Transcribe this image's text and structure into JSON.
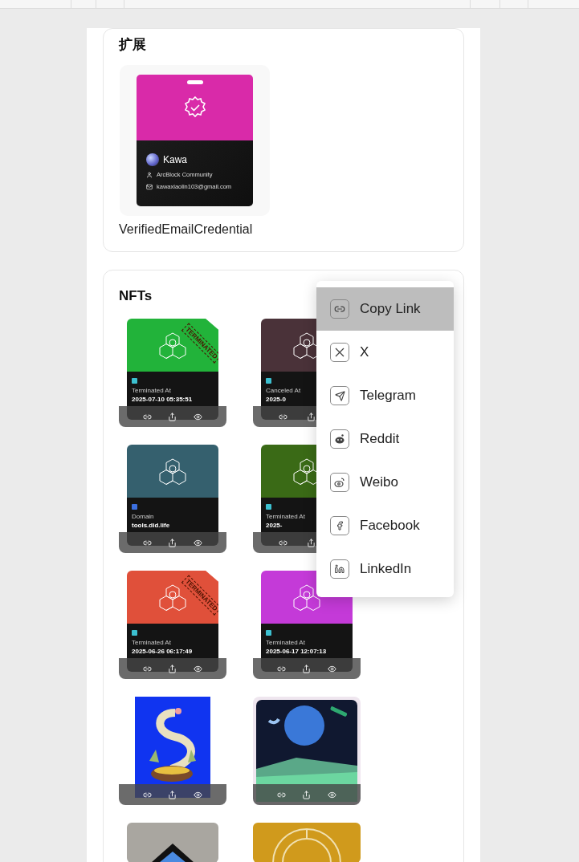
{
  "extensions": {
    "title": "扩展",
    "credential": {
      "name": "Kawa",
      "organization": "ArcBlock Community",
      "email": "kawaxiaolin103@gmail.com",
      "label": "VerifiedEmailCredential"
    }
  },
  "nfts": {
    "title": "NFTs",
    "items": [
      {
        "kind": "certificate",
        "color": "#22b33a",
        "stamp": "TERMINATED",
        "field_label": "Terminated At",
        "field_value": "2025-07-10 05:35:51"
      },
      {
        "kind": "certificate",
        "color": "#4a3239",
        "field_label": "Canceled At",
        "field_value": "2025-0"
      },
      {
        "kind": "domain",
        "color": "#35606e",
        "field_label": "Domain",
        "field_value": "tools.did.life"
      },
      {
        "kind": "certificate",
        "color": "#3a6a16",
        "field_label": "Terminated At",
        "field_value": "2025-"
      },
      {
        "kind": "certificate",
        "color": "#e0503a",
        "stamp": "TERMINATED",
        "field_label": "Terminated At",
        "field_value": "2025-06-26 06:17:49"
      },
      {
        "kind": "certificate",
        "color": "#c43ad8",
        "field_label": "Terminated At",
        "field_value": "2025-06-17 12:07:13"
      },
      {
        "kind": "picture"
      },
      {
        "kind": "picture"
      },
      {
        "kind": "picture"
      },
      {
        "kind": "picture"
      }
    ]
  },
  "share_menu": {
    "items": [
      {
        "label": "Copy Link",
        "selected": true
      },
      {
        "label": "X",
        "selected": false
      },
      {
        "label": "Telegram",
        "selected": false
      },
      {
        "label": "Reddit",
        "selected": false
      },
      {
        "label": "Weibo",
        "selected": false
      },
      {
        "label": "Facebook",
        "selected": false
      },
      {
        "label": "LinkedIn",
        "selected": false
      }
    ]
  }
}
